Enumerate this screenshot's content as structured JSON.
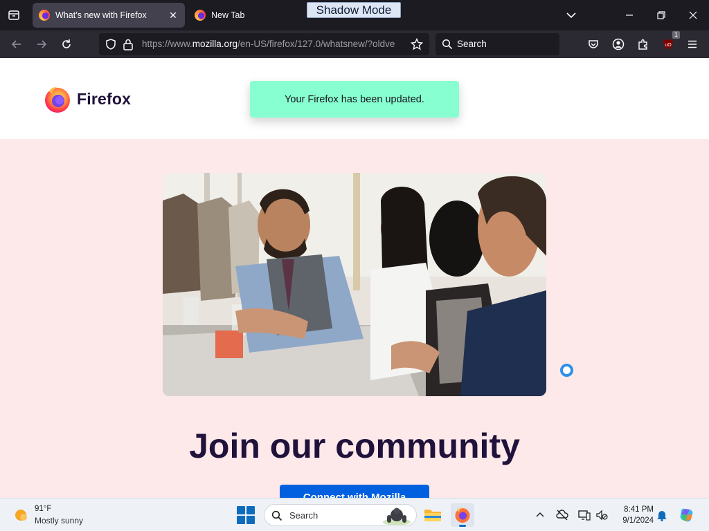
{
  "browser": {
    "tabs": [
      {
        "label": "What’s new with Firefox",
        "active": true
      },
      {
        "label": "New Tab",
        "active": false
      }
    ],
    "shadow_mode_label": "Shadow Mode",
    "url": {
      "prefix": "https://www.",
      "domain": "mozilla.org",
      "path": "/en-US/firefox/127.0/whatsnew/?oldve"
    },
    "search_label": "Search",
    "extension_badge": "1"
  },
  "page": {
    "logo_text": "Firefox",
    "notice": "Your Firefox has been updated.",
    "heading": "Join our community",
    "cta_label": "Connect with Mozilla",
    "colors": {
      "notice_bg": "#88ffd1",
      "page_bg": "#fde8ea",
      "heading": "#20123a",
      "cta_bg": "#0060df"
    }
  },
  "taskbar": {
    "weather": {
      "temp": "91°F",
      "desc": "Mostly sunny"
    },
    "search_label": "Search",
    "time": "8:41 PM",
    "date": "9/1/2024"
  },
  "icons": {
    "list_all_tabs": "list-all-tabs-icon",
    "tab_close": "close-icon",
    "tabs_overflow": "chevron-down-icon",
    "minimize": "minimize-icon",
    "restore": "restore-icon",
    "close_window": "close-icon",
    "back": "back-arrow-icon",
    "forward": "forward-arrow-icon",
    "reload": "reload-icon",
    "tracking_protection": "shield-icon",
    "security": "lock-icon",
    "bookmark": "star-icon",
    "search": "search-icon",
    "pocket": "pocket-icon",
    "account": "account-icon",
    "extensions": "puzzle-icon",
    "ublock": "ublock-origin-icon",
    "menu": "hamburger-menu-icon"
  }
}
